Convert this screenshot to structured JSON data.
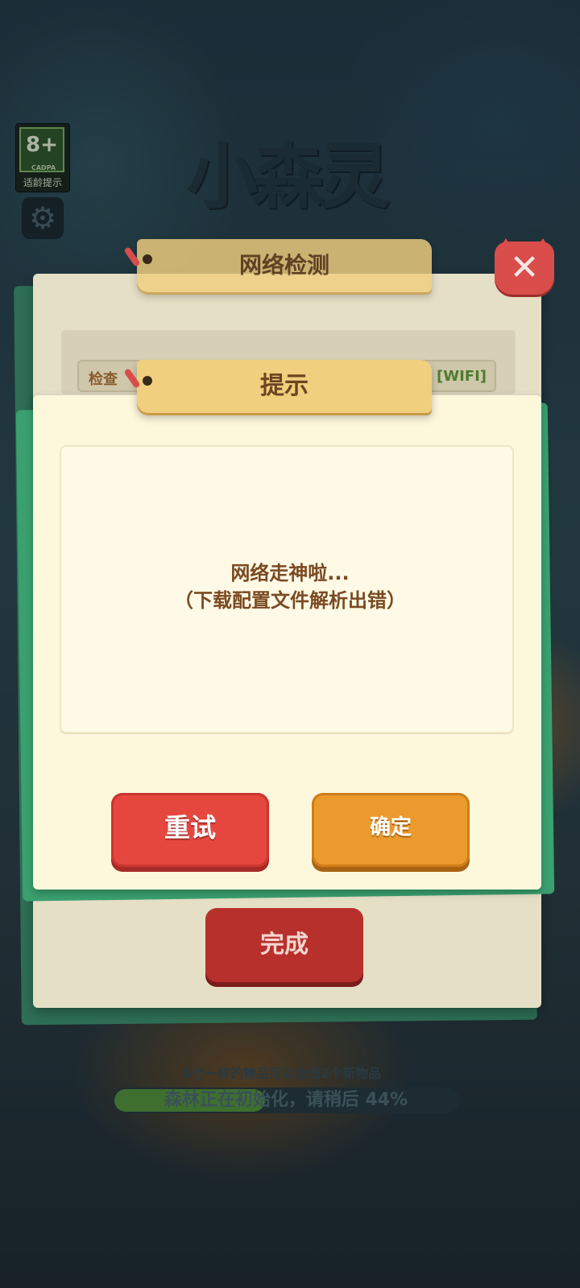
{
  "age_badge": {
    "rating": "8+",
    "org": "CADPA",
    "label": "适龄提示"
  },
  "icons": {
    "settings": "gear-icon",
    "close": "close-icon"
  },
  "logo": {
    "text": "小森灵"
  },
  "network_dialog": {
    "title": "网络检测",
    "row_label": "检查",
    "row_status": "[WIFI]",
    "done_label": "完成"
  },
  "prompt_dialog": {
    "title": "提示",
    "message_line1": "网络走神啦...",
    "message_line2": "（下载配置文件解析出错）",
    "retry_label": "重试",
    "confirm_label": "确定"
  },
  "loading": {
    "hint": "5个一样的物品可以合出2个新物品",
    "status": "森林正在初始化，请稍后 44%",
    "progress": 0.44
  },
  "colors": {
    "retry": "#e5473f",
    "confirm": "#eb9a2d",
    "done": "#b8302c",
    "ribbon": "#f0cf7f",
    "panel_green": "#3aa06f"
  }
}
